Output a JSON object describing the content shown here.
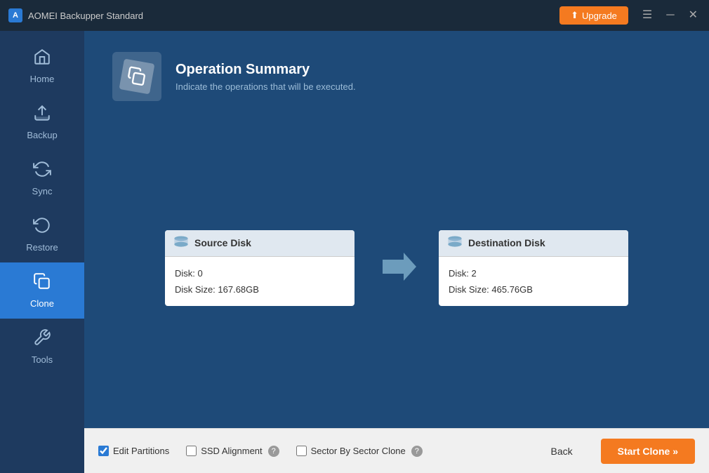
{
  "titleBar": {
    "appTitle": "AOMEI Backupper Standard",
    "upgradeLabel": "Upgrade",
    "menuIcon": "☰",
    "minimizeIcon": "─",
    "closeIcon": "✕"
  },
  "sidebar": {
    "items": [
      {
        "id": "home",
        "label": "Home",
        "icon": "🏠",
        "active": false
      },
      {
        "id": "backup",
        "label": "Backup",
        "icon": "📤",
        "active": false
      },
      {
        "id": "sync",
        "label": "Sync",
        "icon": "🔄",
        "active": false
      },
      {
        "id": "restore",
        "label": "Restore",
        "icon": "🔃",
        "active": false
      },
      {
        "id": "clone",
        "label": "Clone",
        "icon": "📋",
        "active": true
      },
      {
        "id": "tools",
        "label": "Tools",
        "icon": "🔧",
        "active": false
      }
    ]
  },
  "operationSummary": {
    "title": "Operation Summary",
    "subtitle": "Indicate the operations that will be executed."
  },
  "sourceDisk": {
    "header": "Source Disk",
    "line1": "Disk: 0",
    "line2": "Disk Size: 167.68GB"
  },
  "destinationDisk": {
    "header": "Destination Disk",
    "line1": "Disk: 2",
    "line2": "Disk Size: 465.76GB"
  },
  "footer": {
    "editPartitionsLabel": "Edit Partitions",
    "ssdAlignmentLabel": "SSD Alignment",
    "sectorBySectorLabel": "Sector By Sector Clone",
    "backLabel": "Back",
    "startCloneLabel": "Start Clone »"
  }
}
